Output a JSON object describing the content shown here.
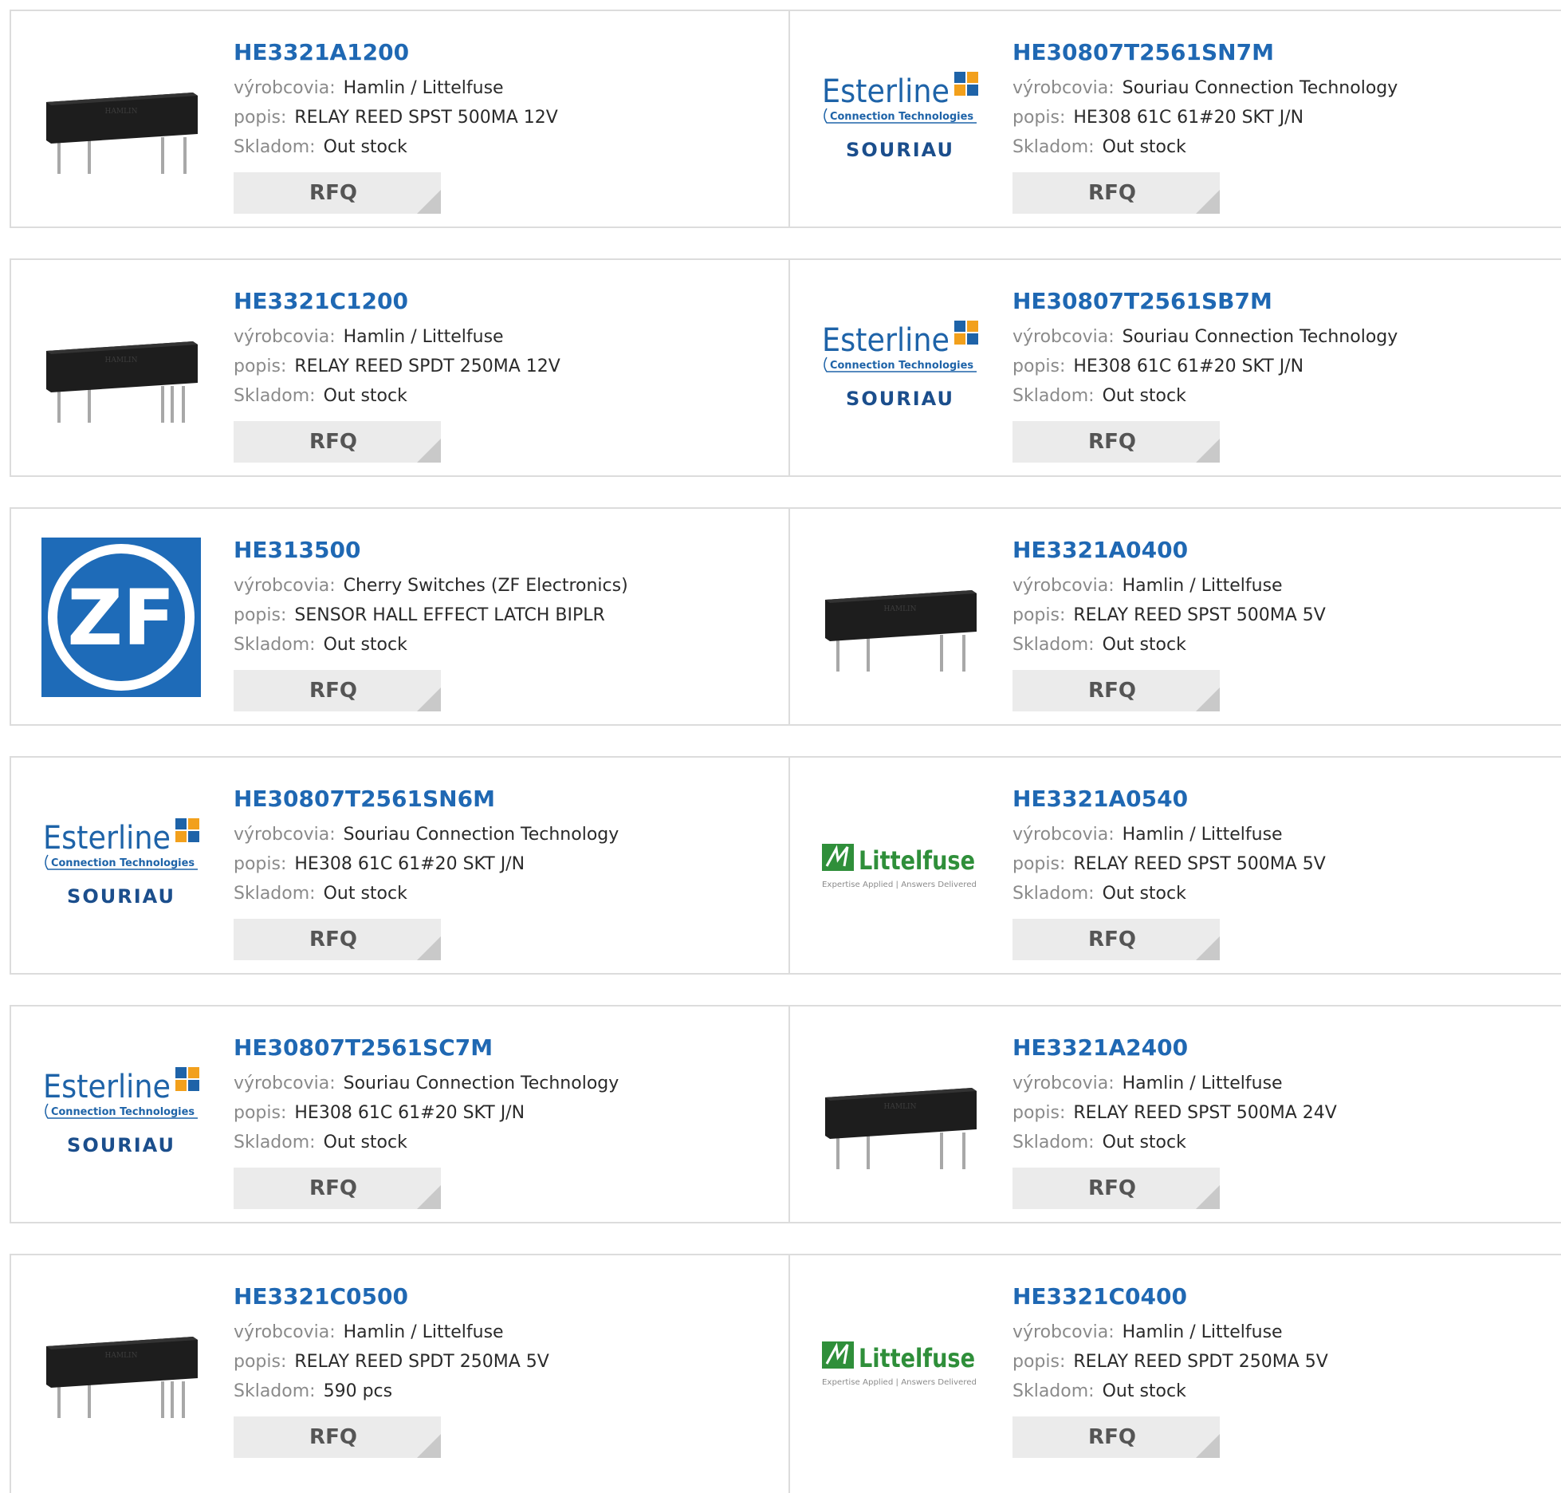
{
  "labels": {
    "manufacturer": "výrobcovia:",
    "description": "popis:",
    "stock": "Skladom:",
    "rfq": "RFQ"
  },
  "brand_text": {
    "esterline": "Esterline",
    "connection_technologies": "Connection Technologies",
    "souriau": "SOURIAU",
    "littelfuse": "Littelfuse",
    "littelfuse_tagline": "Expertise Applied | Answers Delivered",
    "zf": "ZF",
    "relay_marking": "HAMLIN"
  },
  "colors": {
    "part_number_link": "#1f68b3",
    "label_gray": "#8a8a8a",
    "rfq_background": "#ebebeb",
    "border": "#dcdcdc",
    "esterline_blue": "#1e63a8",
    "souriau_blue": "#1b4e8c",
    "zf_blue": "#1e6bb8",
    "littelfuse_green": "#2f8f3a"
  },
  "products": [
    {
      "part_number": "HE3321A1200",
      "manufacturer": "Hamlin / Littelfuse",
      "description": "RELAY REED SPST 500MA 12V",
      "stock": "Out stock",
      "image": "relay-4-pin"
    },
    {
      "part_number": "HE30807T2561SN7M",
      "manufacturer": "Souriau Connection Technology",
      "description": "HE308 61C 61#20 SKT J/N",
      "stock": "Out stock",
      "image": "esterline-souriau-logo"
    },
    {
      "part_number": "HE3321C1200",
      "manufacturer": "Hamlin / Littelfuse",
      "description": "RELAY REED SPDT 250MA 12V",
      "stock": "Out stock",
      "image": "relay-5-pin"
    },
    {
      "part_number": "HE30807T2561SB7M",
      "manufacturer": "Souriau Connection Technology",
      "description": "HE308 61C 61#20 SKT J/N",
      "stock": "Out stock",
      "image": "esterline-souriau-logo"
    },
    {
      "part_number": "HE313500",
      "manufacturer": "Cherry Switches (ZF Electronics)",
      "description": "SENSOR HALL EFFECT LATCH BIPLR",
      "stock": "Out stock",
      "image": "zf-logo"
    },
    {
      "part_number": "HE3321A0400",
      "manufacturer": "Hamlin / Littelfuse",
      "description": "RELAY REED SPST 500MA 5V",
      "stock": "Out stock",
      "image": "relay-4-pin"
    },
    {
      "part_number": "HE30807T2561SN6M",
      "manufacturer": "Souriau Connection Technology",
      "description": "HE308 61C 61#20 SKT J/N",
      "stock": "Out stock",
      "image": "esterline-souriau-logo"
    },
    {
      "part_number": "HE3321A0540",
      "manufacturer": "Hamlin / Littelfuse",
      "description": "RELAY REED SPST 500MA 5V",
      "stock": "Out stock",
      "image": "littelfuse-logo"
    },
    {
      "part_number": "HE30807T2561SC7M",
      "manufacturer": "Souriau Connection Technology",
      "description": "HE308 61C 61#20 SKT J/N",
      "stock": "Out stock",
      "image": "esterline-souriau-logo"
    },
    {
      "part_number": "HE3321A2400",
      "manufacturer": "Hamlin / Littelfuse",
      "description": "RELAY REED SPST 500MA 24V",
      "stock": "Out stock",
      "image": "relay-4-pin"
    },
    {
      "part_number": "HE3321C0500",
      "manufacturer": "Hamlin / Littelfuse",
      "description": "RELAY REED SPDT 250MA 5V",
      "stock": "590 pcs",
      "image": "relay-5-pin"
    },
    {
      "part_number": "HE3321C0400",
      "manufacturer": "Hamlin / Littelfuse",
      "description": "RELAY REED SPDT 250MA 5V",
      "stock": "Out stock",
      "image": "littelfuse-logo"
    }
  ]
}
